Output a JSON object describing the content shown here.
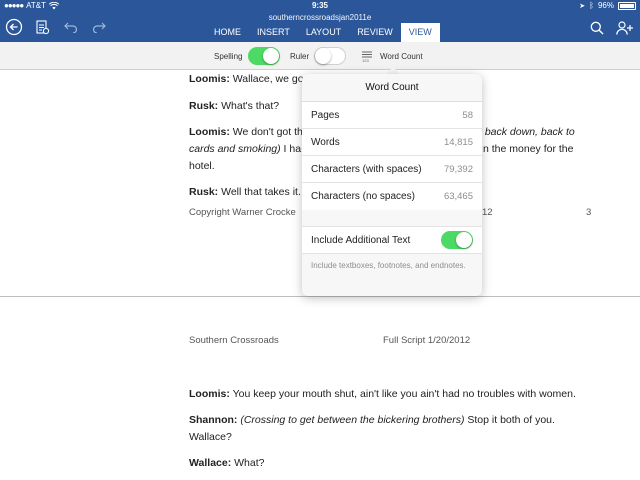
{
  "status_bar": {
    "carrier": "AT&T",
    "time": "9:35",
    "battery": "96%"
  },
  "document": {
    "title": "southerncrossroadsjan2011e"
  },
  "ribbon": {
    "tabs": [
      {
        "label": "HOME"
      },
      {
        "label": "INSERT"
      },
      {
        "label": "LAYOUT"
      },
      {
        "label": "REVIEW"
      },
      {
        "label": "VIEW",
        "active": true
      }
    ]
  },
  "view_toolbar": {
    "spelling_label": "Spelling",
    "spelling_on": true,
    "ruler_label": "Ruler",
    "ruler_on": false,
    "word_count_label": "Word Count"
  },
  "page1": {
    "line1_speaker": "Loomis:",
    "line1_text": " Wallace, we got",
    "line2_speaker": "Rusk:",
    "line2_text": " What's that?",
    "line3_speaker": "Loomis:",
    "line3_text_a": " We don't got th",
    "line3_text_b": "t back down, back to",
    "line3_line2_a": "cards and smoking)",
    "line3_line2_b": " I ha",
    "line3_line2_c": "n the money for the",
    "line3_line3": "hotel.",
    "line4_speaker": "Rusk:",
    "line4_text": " Well that takes it.",
    "footer_left": "Copyright Warner Crocke",
    "footer_mid": "12",
    "footer_page": "3"
  },
  "page2": {
    "header_left": "Southern Crossroads",
    "header_right": "Full Script 1/20/2012",
    "line1_speaker": "Loomis:",
    "line1_text": " You keep your mouth shut, ain't like you ain't had no troubles with women.",
    "line2_speaker": "Shannon:",
    "line2_italic": " (Crossing to get between the bickering brothers)",
    "line2_text": " Stop it both of you.",
    "line2_cont": "Wallace?",
    "line3_speaker": "Wallace:",
    "line3_text": " What?"
  },
  "word_count": {
    "title": "Word Count",
    "rows": [
      {
        "label": "Pages",
        "value": "58"
      },
      {
        "label": "Words",
        "value": "14,815"
      },
      {
        "label": "Characters (with spaces)",
        "value": "79,392"
      },
      {
        "label": "Characters (no spaces)",
        "value": "63,465"
      }
    ],
    "include_label": "Include Additional Text",
    "include_on": true,
    "note": "Include textboxes, footnotes, and endnotes."
  },
  "colors": {
    "ribbon": "#2b579a",
    "toggle_on": "#4cd964",
    "ios_gray": "#8e8e93"
  }
}
